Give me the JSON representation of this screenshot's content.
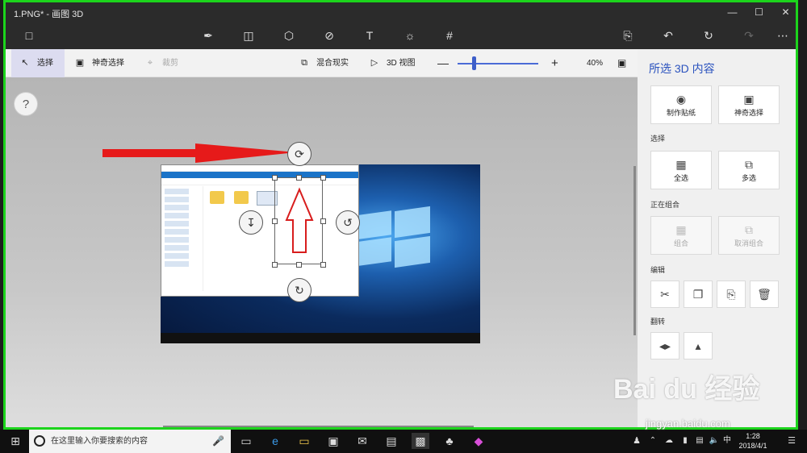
{
  "window": {
    "title": "1.PNG* - 画图 3D"
  },
  "subbar": {
    "select": "选择",
    "magic_select": "神奇选择",
    "crop": "裁剪",
    "mixed_reality": "混合现实",
    "view_3d": "3D 视图",
    "zoom": "40%"
  },
  "canvas": {
    "help": "?"
  },
  "panel": {
    "title": "所选 3D 内容",
    "make_sticker": "制作贴纸",
    "magic_select": "神奇选择",
    "section_select": "选择",
    "select_all": "全选",
    "multi_select": "多选",
    "section_group": "正在组合",
    "group": "组合",
    "ungroup": "取消组合",
    "section_edit": "编辑",
    "section_flip": "翻转"
  },
  "taskbar": {
    "search_placeholder": "在这里输入你要搜索的内容",
    "time": "1:28",
    "date": "2018/4/1",
    "ime": "中"
  },
  "watermark": {
    "brand": "Bai du 经验",
    "url": "jingyan.baidu.com"
  },
  "icons": [
    "folder-icon",
    "brush-icon",
    "2d-shapes-icon",
    "3d-shapes-icon",
    "sticker-icon",
    "text-icon",
    "effects-icon",
    "canvas-icon",
    "paste-icon",
    "undo-icon",
    "history-icon",
    "redo-icon",
    "more-icon"
  ]
}
